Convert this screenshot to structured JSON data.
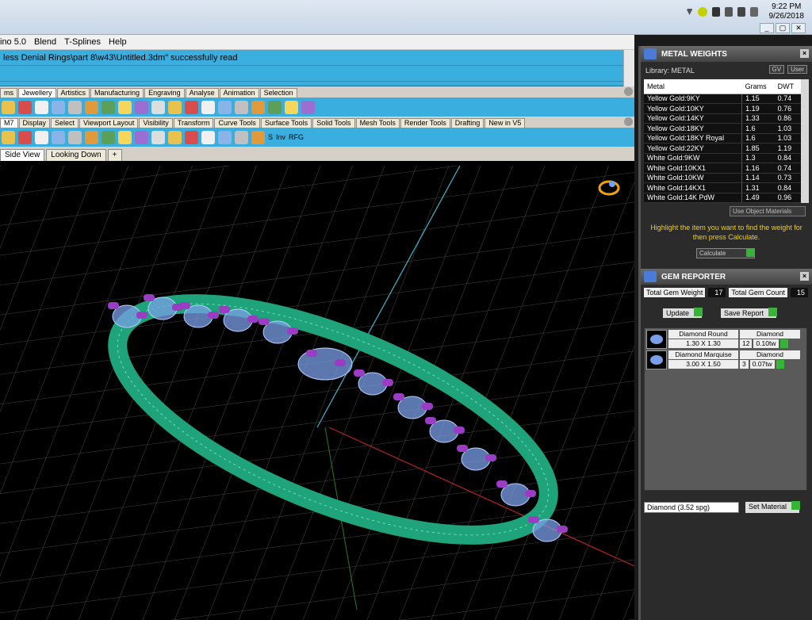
{
  "tray": {
    "time": "9:22 PM",
    "date": "9/26/2018"
  },
  "menu": {
    "app_fragment": "ino 5.0",
    "items": [
      "Blend",
      "T-Splines",
      "Help"
    ]
  },
  "command": {
    "line1": "less Denial Rings\\part 8\\w43\\Untitled.3dm\" successfully read",
    "line2": ""
  },
  "tabs1": [
    "ms",
    "Jewellery",
    "Artistics",
    "Manufacturing",
    "Engraving",
    "Analyse",
    "Animation",
    "Selection"
  ],
  "tabs2": [
    "M7",
    "Display",
    "Select",
    "Viewport Layout",
    "Visibility",
    "Transform",
    "Curve Tools",
    "Surface Tools",
    "Solid Tools",
    "Mesh Tools",
    "Render Tools",
    "Drafting",
    "New in V5"
  ],
  "toolbar2_text": {
    "s": "S",
    "inv": "Inv",
    "rfg": "RFG"
  },
  "viewtabs": [
    "Side View",
    "Looking Down",
    "+"
  ],
  "metal_weights": {
    "title": "METAL WEIGHTS",
    "library": "Library: METAL",
    "btn_gv": "GV",
    "btn_user": "User",
    "headers": [
      "Metal",
      "Grams",
      "DWT"
    ],
    "rows": [
      [
        "Yellow Gold:9KY",
        "1.15",
        "0.74"
      ],
      [
        "Yellow Gold:10KY",
        "1.19",
        "0.76"
      ],
      [
        "Yellow Gold:14KY",
        "1.33",
        "0.86"
      ],
      [
        "Yellow Gold:18KY",
        "1.6",
        "1.03"
      ],
      [
        "Yellow Gold:18KY Royal",
        "1.6",
        "1.03"
      ],
      [
        "Yellow Gold:22KY",
        "1.85",
        "1.19"
      ],
      [
        "White Gold:9KW",
        "1.3",
        "0.84"
      ],
      [
        "White Gold:10KX1",
        "1.16",
        "0.74"
      ],
      [
        "White Gold:10KW",
        "1.14",
        "0.73"
      ],
      [
        "White Gold:14KX1",
        "1.31",
        "0.84"
      ],
      [
        "White Gold:14K PdW",
        "1.49",
        "0.96"
      ]
    ],
    "use_object": "Use Object Materials",
    "hint": "Highlight the item you want to find the weight for then press Calculate.",
    "calculate": "Calculate"
  },
  "gem_reporter": {
    "title": "GEM REPORTER",
    "total_weight_label": "Total Gem Weight",
    "total_weight": "17",
    "total_count_label": "Total Gem Count",
    "total_count": "15",
    "update": "Update",
    "save_report": "Save Report",
    "gems": [
      {
        "name": "Diamond Round",
        "size": "1.30 X 1.30",
        "material": "Diamond",
        "count": "12",
        "weight": "0.10tw"
      },
      {
        "name": "Diamond Marquise",
        "size": "3.00 X 1.50",
        "material": "Diamond",
        "count": "3",
        "weight": "0.07tw"
      }
    ],
    "material_select": "Diamond     (3.52 spg)",
    "set_material": "Set Material"
  },
  "colors": {
    "toolbar_blue": "#3aaede",
    "hint_yellow": "#f3d000",
    "band_green": "#1fa37a",
    "prong_purple": "#9a3cc4",
    "gem_blue": "#7a9fe8"
  }
}
